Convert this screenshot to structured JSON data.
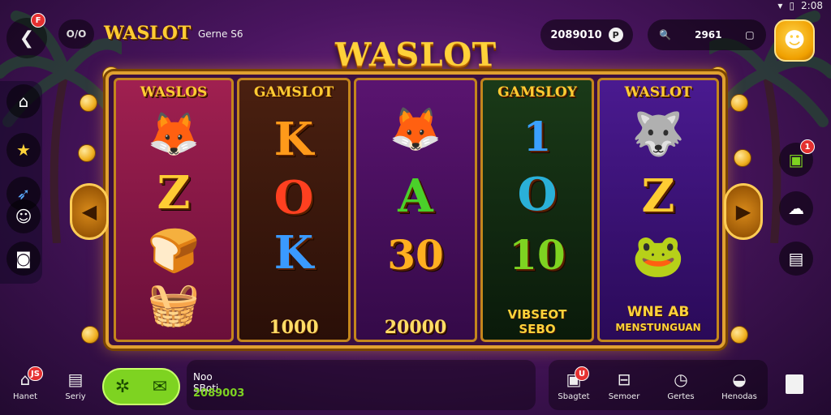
{
  "topbar": {
    "back_badge": "F",
    "menu_label": "O/O",
    "logo": "WASLOT",
    "game_label": "Gerne S6",
    "balance": "2089010",
    "balance_icon": "P",
    "search_value": "2961",
    "status_time": "2:08"
  },
  "title": "WASLOT",
  "reels": [
    {
      "header": "WASLOS",
      "symbols": [
        "🦊",
        "Z",
        "🍞",
        "🧺"
      ],
      "bg": "#8a1a4a"
    },
    {
      "header": "GAMSLOT",
      "symbols": [
        "K",
        "O",
        "K",
        "1000"
      ],
      "bg": "#3a1a10"
    },
    {
      "header": "",
      "symbols": [
        "🦊",
        "A",
        "30",
        "20000"
      ],
      "bg": "#4a1060"
    },
    {
      "header": "GAMSLOY",
      "symbols": [
        "1",
        "O",
        "10",
        "VIBSEOT"
      ],
      "bg": "#0e2a10"
    },
    {
      "header": "WASLOT",
      "symbols": [
        "🐺",
        "Z",
        "🐸",
        "WNE AB"
      ],
      "bg": "#3a1070"
    }
  ],
  "reel_captions": {
    "r4_line2": "SEBO",
    "r5_line2": "MENSTUNGUAN"
  },
  "colors": {
    "accent": "#ffcc33",
    "green": "#7ed321",
    "badge": "#e53030"
  },
  "bottombar": {
    "home_label": "Hanet",
    "home_badge": "JS",
    "saving_label": "Seriy",
    "promo_title": "Noo SBoti",
    "promo_value": "2089003",
    "nav": [
      {
        "label": "Sbagtet",
        "icon": "gift-icon",
        "badge": "U"
      },
      {
        "label": "Semoer",
        "icon": "store-icon"
      },
      {
        "label": "Gertes",
        "icon": "clock-icon"
      },
      {
        "label": "Henodas",
        "icon": "bag-icon"
      }
    ]
  }
}
